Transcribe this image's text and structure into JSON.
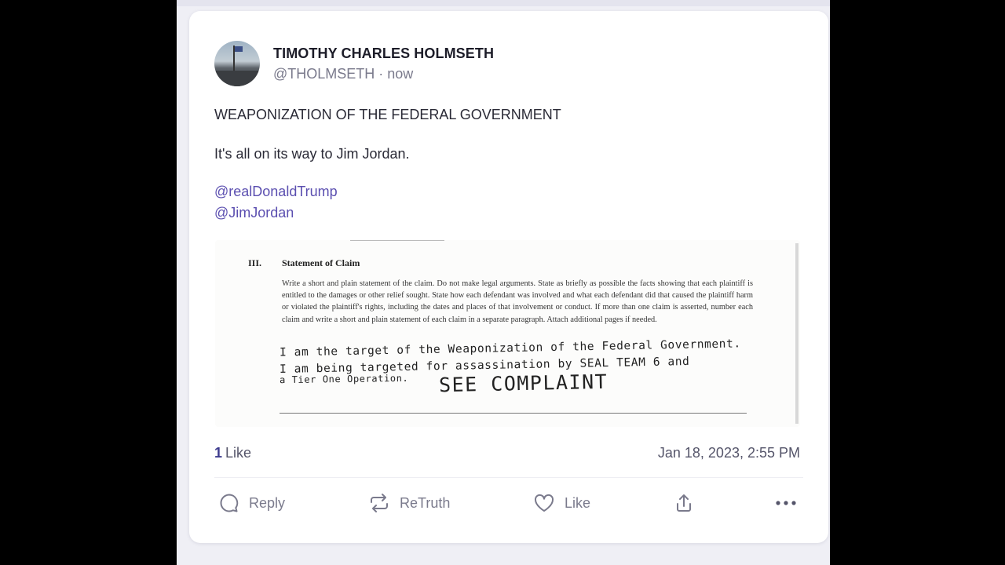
{
  "post": {
    "display_name": "TIMOTHY CHARLES HOLMSETH",
    "handle": "@THOLMSETH",
    "time_sep": " · ",
    "posted": "now",
    "title": "WEAPONIZATION OF THE FEDERAL GOVERNMENT",
    "body": "It's all on its way to Jim Jordan.",
    "mentions": [
      "@realDonaldTrump",
      "@JimJordan"
    ],
    "attachment": {
      "section_number": "III.",
      "heading": "Statement of Claim",
      "instructions": "Write a short and plain statement of the claim.  Do not make legal arguments.  State as briefly as possible the facts showing that each plaintiff is entitled to the damages or other relief sought.  State how each defendant was involved and what each defendant did that caused the plaintiff harm or violated the plaintiff's rights, including the dates and places of that involvement or conduct.  If more than one claim is asserted, number each claim and write a short and plain statement of each claim in a separate paragraph.  Attach additional pages if needed.",
      "handwritten": [
        "I am the target of the Weaponization of the Federal Government.",
        "I am being targeted for assassination by SEAL TEAM 6 and",
        "a Tier One Operation."
      ],
      "handwritten_large": "SEE COMPLAINT"
    },
    "like_count": "1",
    "like_label": "Like",
    "timestamp": "Jan 18, 2023, 2:55 PM"
  },
  "actions": {
    "reply": "Reply",
    "retruth": "ReTruth",
    "like": "Like"
  },
  "icons": {
    "reply": "chat-bubble-icon",
    "retruth": "repost-icon",
    "like": "heart-icon",
    "share": "share-icon",
    "more": "more-dots-icon"
  },
  "colors": {
    "mention": "#5b4fb0",
    "like_count": "#3d3b8e",
    "muted": "#7a7a8c"
  }
}
